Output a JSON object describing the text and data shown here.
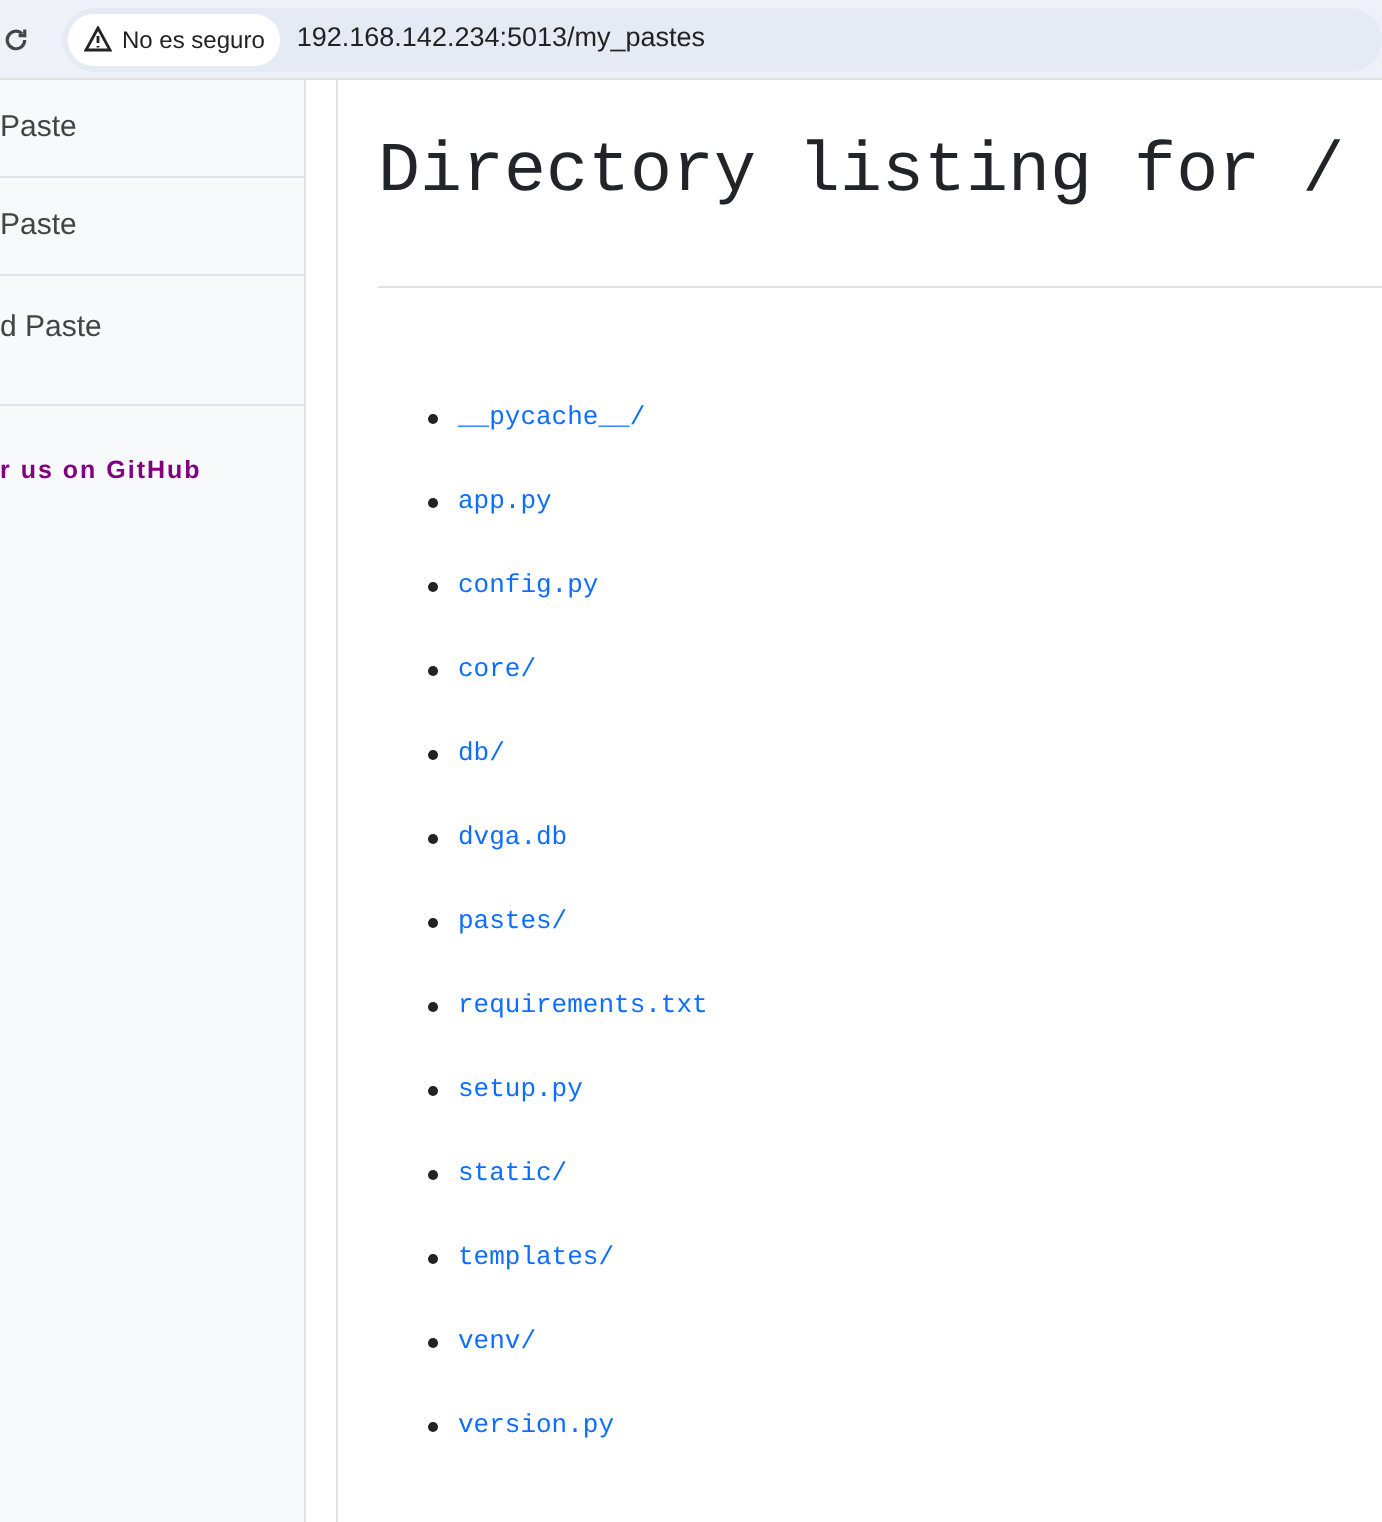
{
  "address_bar": {
    "security_badge": "No es seguro",
    "url": "192.168.142.234:5013/my_pastes"
  },
  "sidebar": {
    "items": [
      {
        "label": "Paste"
      },
      {
        "label": "Paste"
      },
      {
        "label": "d Paste"
      }
    ],
    "github_link": "r us on GitHub"
  },
  "content": {
    "title": "Directory listing for /",
    "entries": [
      "__pycache__/",
      "app.py",
      "config.py",
      "core/",
      "db/",
      "dvga.db",
      "pastes/",
      "requirements.txt",
      "setup.py",
      "static/",
      "templates/",
      "venv/",
      "version.py"
    ]
  }
}
